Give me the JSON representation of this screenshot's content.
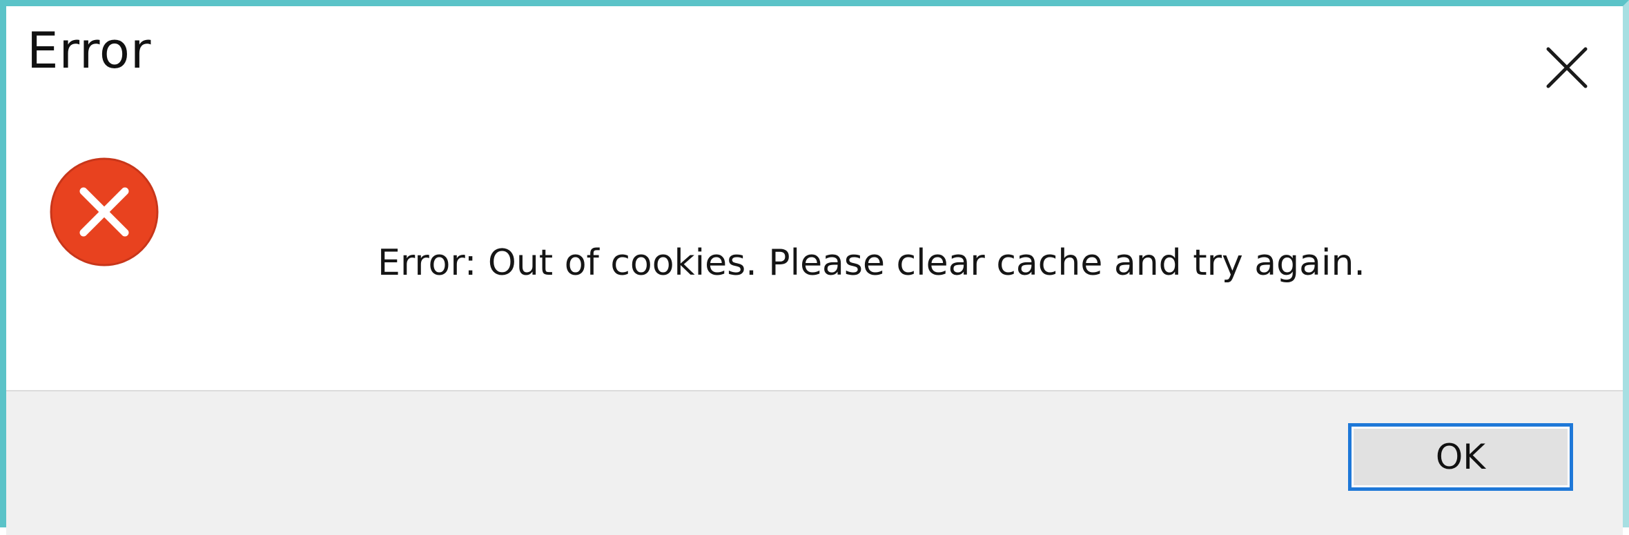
{
  "dialog": {
    "title": "Error",
    "message": "Error: Out of cookies. Please clear cache and try again.",
    "ok_label": "OK",
    "icons": {
      "close": "close-icon",
      "error": "error-icon"
    }
  },
  "colors": {
    "error_red": "#e8421f",
    "focus_border": "#1e78d8",
    "window_border": "#5bc3c8",
    "footer_bg": "#f0f0f0"
  }
}
